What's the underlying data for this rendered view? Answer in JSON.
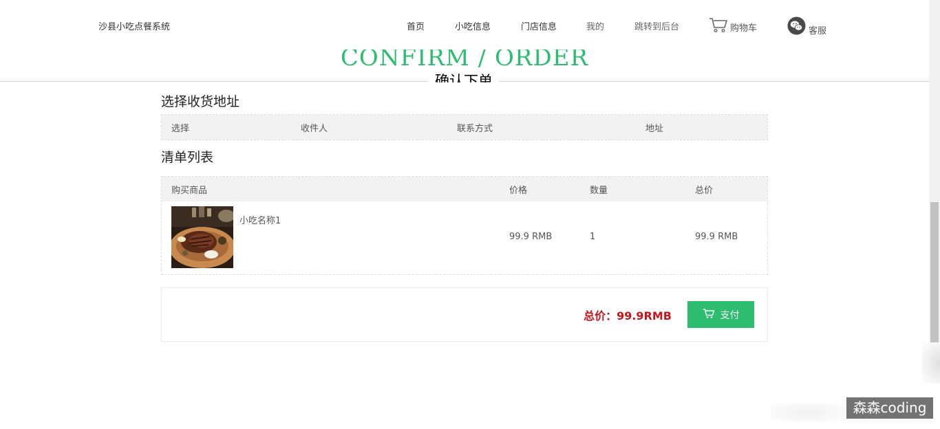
{
  "header": {
    "brand": "沙县小吃点餐系统",
    "nav": {
      "home": "首页",
      "snacks": "小吃信息",
      "stores": "门店信息",
      "mine": "我的",
      "backend": "跳转到后台",
      "cart": "购物车",
      "service": "客服"
    }
  },
  "page": {
    "heading_en": "CONFIRM / ORDER",
    "heading_cn": "确认下单"
  },
  "address_section": {
    "title": "选择收货地址",
    "columns": [
      "选择",
      "收件人",
      "联系方式",
      "地址"
    ]
  },
  "order_section": {
    "title": "清单列表",
    "columns": [
      "购买商品",
      "价格",
      "数量",
      "总价"
    ],
    "items": [
      {
        "name": "小吃名称1",
        "price": "99.9 RMB",
        "quantity": "1",
        "subtotal": "99.9 RMB"
      }
    ]
  },
  "summary": {
    "total_label": "总价：99.9RMB",
    "pay_label": "支付"
  },
  "watermark": "森森coding",
  "colors": {
    "accent": "#2dbd6e",
    "total_red": "#c5141a"
  },
  "icons": {
    "cart": "cart-icon",
    "wechat": "wechat-icon",
    "pay": "cart-icon"
  }
}
